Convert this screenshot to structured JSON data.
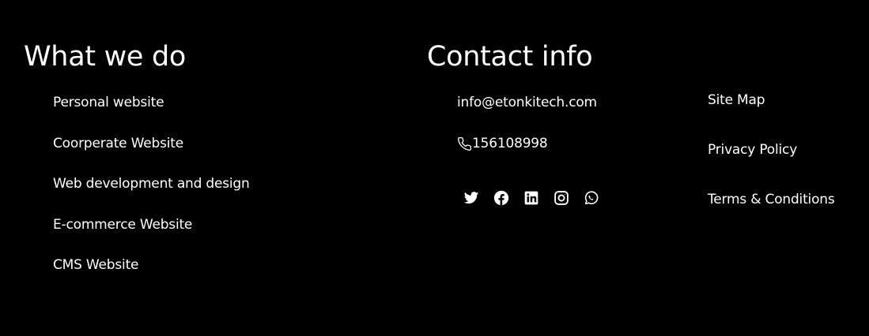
{
  "services": {
    "heading": "What we do",
    "items": [
      {
        "label": "Personal website"
      },
      {
        "label": "Coorperate Website"
      },
      {
        "label": "Web development and design"
      },
      {
        "label": "E-commerce Website"
      },
      {
        "label": "CMS Website"
      }
    ]
  },
  "contact": {
    "heading": "Contact info",
    "email": "info@etonkitech.com",
    "phone": "156108998",
    "phone_icon": "phone-icon",
    "social": [
      {
        "icon": "twitter-icon"
      },
      {
        "icon": "facebook-icon"
      },
      {
        "icon": "linkedin-icon"
      },
      {
        "icon": "instagram-icon"
      },
      {
        "icon": "whatsapp-icon"
      }
    ]
  },
  "legal": {
    "items": [
      {
        "label": "Site Map"
      },
      {
        "label": "Privacy Policy"
      },
      {
        "label": "Terms & Conditions"
      }
    ]
  },
  "colors": {
    "background": "#000000",
    "text": "#ffffff"
  }
}
